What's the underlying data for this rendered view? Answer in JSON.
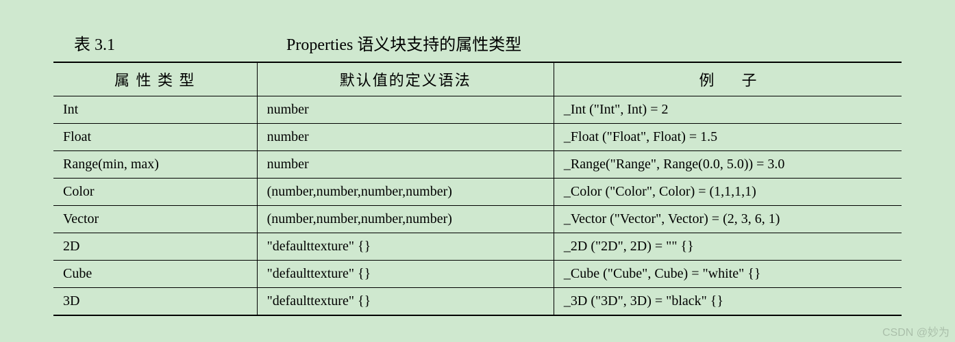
{
  "caption": {
    "label": "表 3.1",
    "title": "Properties 语义块支持的属性类型"
  },
  "headers": {
    "col1": "属 性 类 型",
    "col2": "默认值的定义语法",
    "col3_a": "例",
    "col3_b": "子"
  },
  "rows": [
    {
      "type": "Int",
      "syntax": "number",
      "example": "_Int (\"Int\", Int) = 2"
    },
    {
      "type": "Float",
      "syntax": "number",
      "example": "_Float (\"Float\", Float) = 1.5"
    },
    {
      "type": "Range(min, max)",
      "syntax": "number",
      "example": "_Range(\"Range\", Range(0.0, 5.0)) = 3.0"
    },
    {
      "type": "Color",
      "syntax": "(number,number,number,number)",
      "example": "_Color (\"Color\", Color) = (1,1,1,1)"
    },
    {
      "type": "Vector",
      "syntax": "(number,number,number,number)",
      "example": "_Vector (\"Vector\", Vector) = (2, 3, 6, 1)"
    },
    {
      "type": "2D",
      "syntax": "\"defaulttexture\" {}",
      "example": "_2D (\"2D\", 2D) = \"\" {}"
    },
    {
      "type": "Cube",
      "syntax": "\"defaulttexture\" {}",
      "example": "_Cube (\"Cube\", Cube) = \"white\" {}"
    },
    {
      "type": "3D",
      "syntax": "\"defaulttexture\" {}",
      "example": "_3D (\"3D\", 3D) = \"black\" {}"
    }
  ],
  "watermark": "CSDN @妙为"
}
